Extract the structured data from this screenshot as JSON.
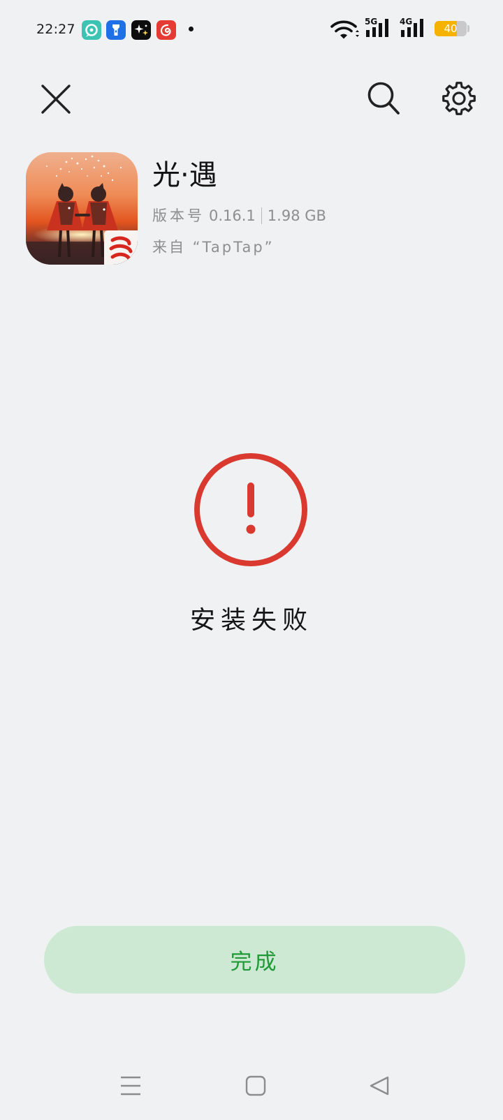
{
  "status_bar": {
    "time": "22:27",
    "notification_icons": [
      "disc-app-icon",
      "flashlight-app-icon",
      "sparkle-app-icon",
      "netease-music-icon"
    ],
    "wifi_icon": "wifi-icon",
    "signals": [
      {
        "label": "5G",
        "icon": "cellular-signal-icon"
      },
      {
        "label": "4G",
        "icon": "cellular-signal-icon"
      }
    ],
    "battery_level": "40",
    "battery_color": "#f5b300"
  },
  "toolbar": {
    "close_icon": "close-icon",
    "search_icon": "search-icon",
    "settings_icon": "gear-icon"
  },
  "app": {
    "icon": "sky-game-icon",
    "name": "光·遇",
    "version_label": "版本号",
    "version": "0.16.1",
    "size": "1.98 GB",
    "source": "来自 “TapTap”"
  },
  "result": {
    "icon": "error-icon",
    "message": "安装失败",
    "color": "#d9392e"
  },
  "actions": {
    "done_label": "完成",
    "done_bg": "#cde9d3",
    "done_color": "#1f9a36"
  },
  "nav_bar": {
    "icons": [
      "menu-icon",
      "home-icon",
      "back-icon"
    ]
  }
}
